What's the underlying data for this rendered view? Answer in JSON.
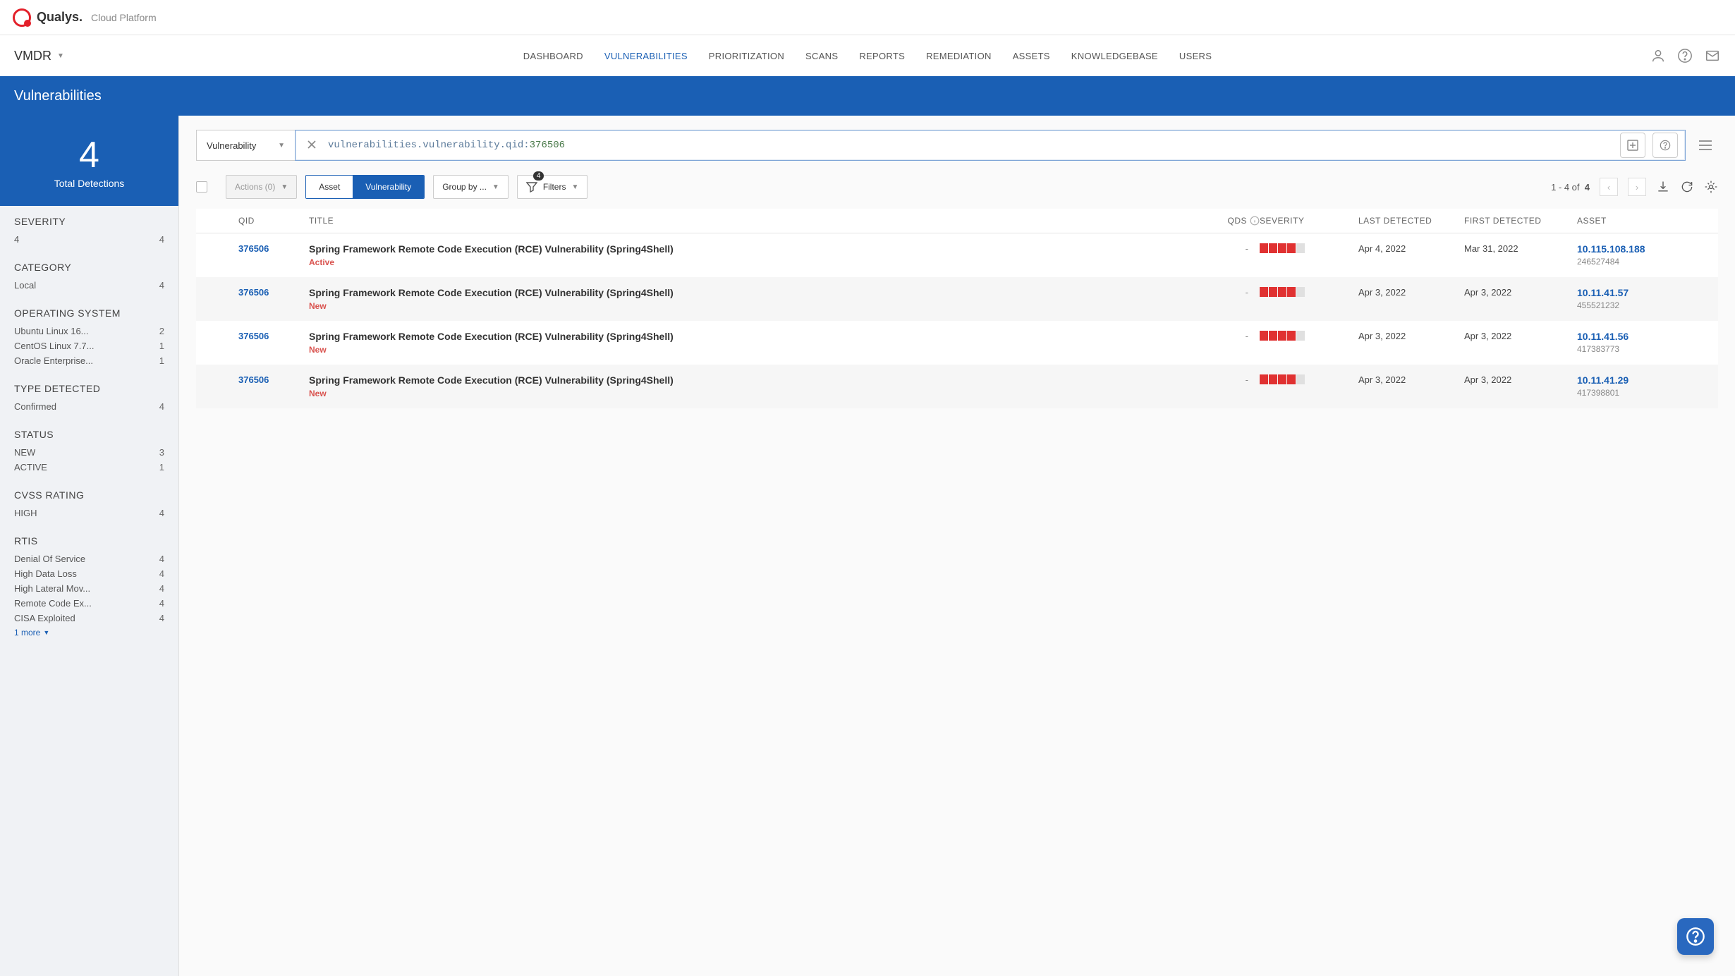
{
  "brand": {
    "name": "Qualys.",
    "sub": "Cloud Platform"
  },
  "module": "VMDR",
  "nav": {
    "items": [
      "DASHBOARD",
      "VULNERABILITIES",
      "PRIORITIZATION",
      "SCANS",
      "REPORTS",
      "REMEDIATION",
      "ASSETS",
      "KNOWLEDGEBASE",
      "USERS"
    ],
    "active": "VULNERABILITIES"
  },
  "page_title": "Vulnerabilities",
  "sidebar": {
    "count": "4",
    "count_label": "Total Detections",
    "facets": [
      {
        "title": "SEVERITY",
        "items": [
          {
            "label": "4",
            "count": "4"
          }
        ]
      },
      {
        "title": "CATEGORY",
        "items": [
          {
            "label": "Local",
            "count": "4"
          }
        ]
      },
      {
        "title": "OPERATING SYSTEM",
        "items": [
          {
            "label": "Ubuntu Linux 16...",
            "count": "2"
          },
          {
            "label": "CentOS Linux 7.7...",
            "count": "1"
          },
          {
            "label": "Oracle Enterprise...",
            "count": "1"
          }
        ]
      },
      {
        "title": "TYPE DETECTED",
        "items": [
          {
            "label": "Confirmed",
            "count": "4"
          }
        ]
      },
      {
        "title": "STATUS",
        "items": [
          {
            "label": "NEW",
            "count": "3"
          },
          {
            "label": "ACTIVE",
            "count": "1"
          }
        ]
      },
      {
        "title": "CVSS RATING",
        "items": [
          {
            "label": "HIGH",
            "count": "4"
          }
        ]
      },
      {
        "title": "RTIS",
        "items": [
          {
            "label": "Denial Of Service",
            "count": "4"
          },
          {
            "label": "High Data Loss",
            "count": "4"
          },
          {
            "label": "High Lateral Mov...",
            "count": "4"
          },
          {
            "label": "Remote Code Ex...",
            "count": "4"
          },
          {
            "label": "CISA Exploited",
            "count": "4"
          }
        ],
        "more": "1 more"
      }
    ]
  },
  "search": {
    "type": "Vulnerability",
    "key": "vulnerabilities.vulnerability.qid:",
    "val": "376506"
  },
  "toolbar": {
    "actions": "Actions (0)",
    "toggle": {
      "off": "Asset",
      "on": "Vulnerability"
    },
    "groupby": "Group by ...",
    "filters": "Filters",
    "filter_count": "4",
    "pager": "1 - 4 of",
    "pager_total": "4"
  },
  "columns": {
    "qid": "QID",
    "title": "TITLE",
    "qds": "QDS",
    "severity": "SEVERITY",
    "last": "LAST DETECTED",
    "first": "FIRST DETECTED",
    "asset": "ASSET"
  },
  "rows": [
    {
      "qid": "376506",
      "title": "Spring Framework Remote Code Execution (RCE) Vulnerability (Spring4Shell)",
      "status": "Active",
      "status_class": "active",
      "qds": "-",
      "sev": 4,
      "last": "Apr 4, 2022",
      "first": "Mar 31, 2022",
      "asset_ip": "10.115.108.188",
      "asset_id": "246527484"
    },
    {
      "qid": "376506",
      "title": "Spring Framework Remote Code Execution (RCE) Vulnerability (Spring4Shell)",
      "status": "New",
      "status_class": "new",
      "qds": "-",
      "sev": 4,
      "last": "Apr 3, 2022",
      "first": "Apr 3, 2022",
      "asset_ip": "10.11.41.57",
      "asset_id": "455521232"
    },
    {
      "qid": "376506",
      "title": "Spring Framework Remote Code Execution (RCE) Vulnerability (Spring4Shell)",
      "status": "New",
      "status_class": "new",
      "qds": "-",
      "sev": 4,
      "last": "Apr 3, 2022",
      "first": "Apr 3, 2022",
      "asset_ip": "10.11.41.56",
      "asset_id": "417383773"
    },
    {
      "qid": "376506",
      "title": "Spring Framework Remote Code Execution (RCE) Vulnerability (Spring4Shell)",
      "status": "New",
      "status_class": "new",
      "qds": "-",
      "sev": 4,
      "last": "Apr 3, 2022",
      "first": "Apr 3, 2022",
      "asset_ip": "10.11.41.29",
      "asset_id": "417398801"
    }
  ]
}
